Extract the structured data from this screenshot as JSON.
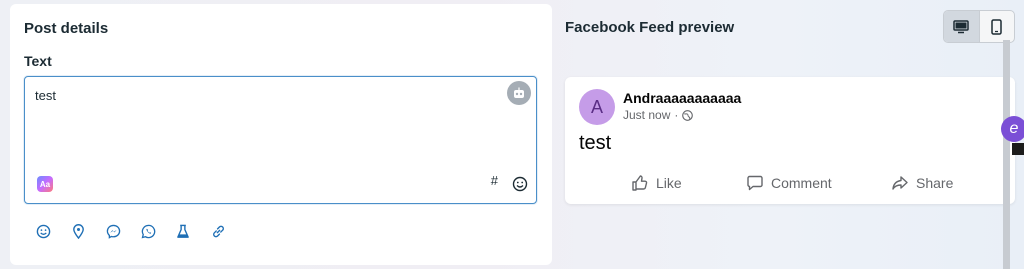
{
  "post_details": {
    "title": "Post details",
    "text_label": "Text",
    "text_value": "test",
    "format_badge": "Aa",
    "hashtag_symbol": "#",
    "toolbar_icons": [
      "emoji-icon",
      "location-icon",
      "messenger-icon",
      "whatsapp-icon",
      "lab-icon",
      "link-icon"
    ]
  },
  "preview": {
    "title": "Facebook Feed preview",
    "device_toggle": {
      "desktop_active": true,
      "mobile_active": false
    },
    "post": {
      "avatar_initial": "A",
      "author": "Andraaaaaaaaaaa",
      "timestamp": "Just now",
      "separator": "·",
      "body": "test",
      "actions": {
        "like": "Like",
        "comment": "Comment",
        "share": "Share"
      }
    }
  },
  "overlay": {
    "badge_letter": "e"
  },
  "colors": {
    "focus_border": "#4a8fc9",
    "icon_blue": "#1f6fb5",
    "avatar_bg": "#c59ce8",
    "badge_purple": "#7b4fd6"
  }
}
